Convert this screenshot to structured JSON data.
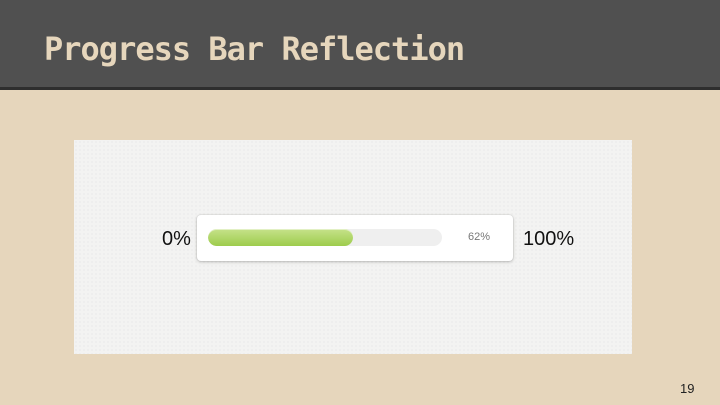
{
  "slide": {
    "title": "Progress Bar Reflection",
    "page_number": "19"
  },
  "progress": {
    "min_label": "0%",
    "max_label": "100%",
    "value_label": "62%",
    "value_fraction": 0.62
  },
  "colors": {
    "header_bg": "#505050",
    "slide_bg": "#e6d6bc",
    "title_text": "#e6d6bc",
    "bar_fill": "#a8d65a",
    "bar_track": "#efefef"
  }
}
